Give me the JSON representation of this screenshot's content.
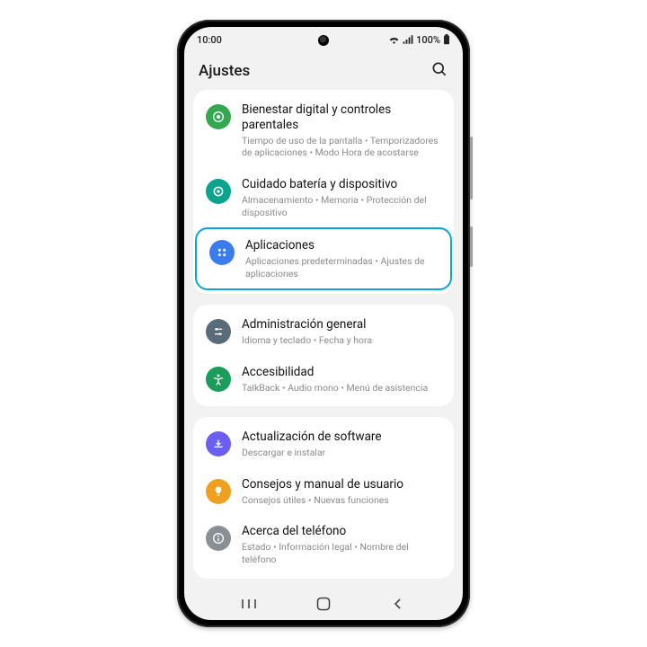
{
  "status": {
    "time": "10:00",
    "battery": "100%"
  },
  "page_title": "Ajustes",
  "groups": [
    {
      "items": [
        {
          "key": "digital-wellbeing",
          "icon": "wellbeing-icon",
          "color": "#35a84f",
          "title": "Bienestar digital y controles parentales",
          "subtitle": "Tiempo de uso de la pantalla  •  Temporizadores de aplicaciones  •  Modo Hora de acostarse",
          "highlight": false
        },
        {
          "key": "battery-device-care",
          "icon": "device-care-icon",
          "color": "#0aa38d",
          "title": "Cuidado batería y dispositivo",
          "subtitle": "Almacenamiento  •  Memoria  •  Protección del dispositivo",
          "highlight": false
        },
        {
          "key": "apps",
          "icon": "apps-icon",
          "color": "#3a7bf0",
          "title": "Aplicaciones",
          "subtitle": "Aplicaciones predeterminadas  •  Ajustes de aplicaciones",
          "highlight": true
        }
      ]
    },
    {
      "items": [
        {
          "key": "general-management",
          "icon": "general-icon",
          "color": "#5a6b7a",
          "title": "Administración general",
          "subtitle": "Idioma y teclado  •  Fecha y hora",
          "highlight": false
        },
        {
          "key": "accessibility",
          "icon": "accessibility-icon",
          "color": "#1a9c5a",
          "title": "Accesibilidad",
          "subtitle": "TalkBack  •  Audio mono  •  Menú de asistencia",
          "highlight": false
        }
      ]
    },
    {
      "items": [
        {
          "key": "software-update",
          "icon": "update-icon",
          "color": "#6a5ff0",
          "title": "Actualización de software",
          "subtitle": "Descargar e instalar",
          "highlight": false
        },
        {
          "key": "tips",
          "icon": "tips-icon",
          "color": "#f0a020",
          "title": "Consejos y manual de usuario",
          "subtitle": "Consejos útiles  •  Nuevas funciones",
          "highlight": false
        },
        {
          "key": "about-phone",
          "icon": "about-icon",
          "color": "#8a8f95",
          "title": "Acerca del teléfono",
          "subtitle": "Estado  •  Información legal  •  Nombre del teléfono",
          "highlight": false
        }
      ]
    }
  ]
}
